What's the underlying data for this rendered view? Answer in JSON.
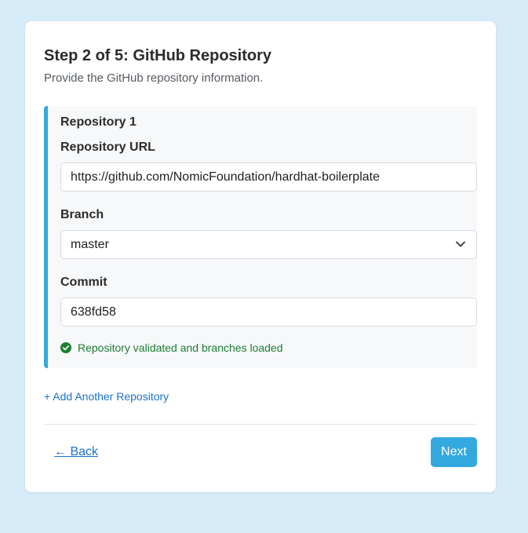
{
  "step": {
    "title": "Step 2 of 5: GitHub Repository",
    "subtitle": "Provide the GitHub repository information."
  },
  "repository": {
    "heading": "Repository 1",
    "url_label": "Repository URL",
    "url_value": "https://github.com/NomicFoundation/hardhat-boilerplate",
    "branch_label": "Branch",
    "branch_value": "master",
    "commit_label": "Commit",
    "commit_value": "638fd58",
    "status_text": "Repository validated and branches loaded"
  },
  "actions": {
    "add_repository": "+ Add Another Repository",
    "back": "← Back",
    "next": "Next"
  },
  "colors": {
    "accent": "#33a9e0",
    "link": "#1a73c8",
    "success": "#1e7e34",
    "background": "#d6ecf8"
  },
  "icons": {
    "status": "check-circle-icon",
    "branch_dropdown": "chevron-down-icon"
  }
}
